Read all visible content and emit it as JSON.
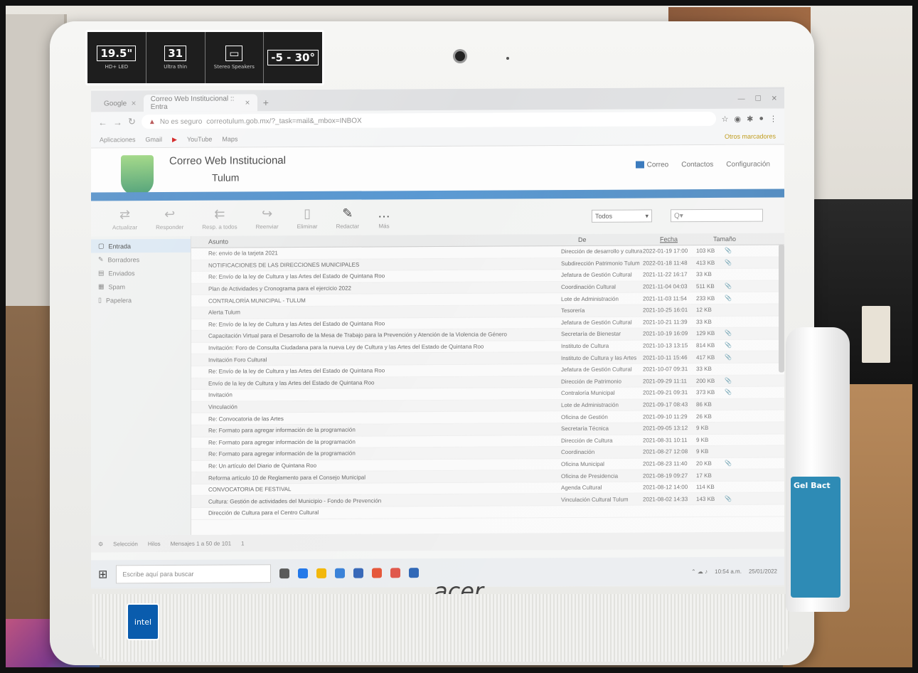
{
  "monitor": {
    "brand": "acer",
    "badge": "intel",
    "specs": [
      {
        "big": "19.5\"",
        "small": "HD+ LED"
      },
      {
        "big": "31",
        "small": "Ultra thin"
      },
      {
        "big": "▭",
        "small": "Stereo Speakers"
      },
      {
        "big": "-5 - 30°",
        "small": ""
      }
    ]
  },
  "bottle": {
    "label": "Gel Bact"
  },
  "browser": {
    "tabs": [
      {
        "label": "Google"
      },
      {
        "label": "Correo Web Institucional :: Entra"
      }
    ],
    "address": {
      "security": "No es seguro",
      "url": "correotulum.gob.mx/?_task=mail&_mbox=INBOX"
    },
    "bookmarks": [
      "Aplicaciones",
      "Gmail",
      "YouTube",
      "Maps"
    ],
    "bookmarks_right": "Otros marcadores"
  },
  "app": {
    "title": "Correo Web Institucional",
    "subtitle": "Tulum",
    "nav": {
      "mail": "Correo",
      "contacts": "Contactos",
      "settings": "Configuración"
    },
    "toolbar": {
      "tools": [
        "Actualizar",
        "Responder",
        "Resp. a todos",
        "Reenviar",
        "Eliminar",
        "Redactar",
        "Más"
      ],
      "filter": "Todos",
      "search_placeholder": "Q▾"
    },
    "folders": [
      "Entrada",
      "Borradores",
      "Enviados",
      "Spam",
      "Papelera"
    ],
    "columns": {
      "subject": "Asunto",
      "from": "De",
      "date": "Fecha",
      "size": "Tamaño"
    },
    "messages": [
      {
        "subject": "Re: envio de la tarjeta 2021",
        "from": "Dirección de desarrollo y cultura",
        "date": "2022-01-19 17:00",
        "size": "103 KB",
        "att": "📎"
      },
      {
        "subject": "NOTIFICACIONES DE LAS DIRECCIONES MUNICIPALES",
        "from": "Subdirección Patrimonio Tulum",
        "date": "2022-01-18 11:48",
        "size": "413 KB",
        "att": "📎"
      },
      {
        "subject": "Re: Envío de la ley de Cultura y las Artes del Estado de Quintana Roo",
        "from": "Jefatura de Gestión Cultural",
        "date": "2021-11-22 16:17",
        "size": "33 KB",
        "att": ""
      },
      {
        "subject": "Plan de Actividades y Cronograma para el ejercicio 2022",
        "from": "Coordinación Cultural",
        "date": "2021-11-04 04:03",
        "size": "511 KB",
        "att": "📎"
      },
      {
        "subject": "CONTRALORÍA MUNICIPAL - TULUM",
        "from": "Lote de Administración",
        "date": "2021-11-03 11:54",
        "size": "233 KB",
        "att": "📎"
      },
      {
        "subject": "Alerta Tulum",
        "from": "Tesorería",
        "date": "2021-10-25 16:01",
        "size": "12 KB",
        "att": ""
      },
      {
        "subject": "Re: Envío de la ley de Cultura y las Artes del Estado de Quintana Roo",
        "from": "Jefatura de Gestión Cultural",
        "date": "2021-10-21 11:39",
        "size": "33 KB",
        "att": ""
      },
      {
        "subject": "Capacitación Virtual para el Desarrollo de la Mesa de Trabajo para la Prevención y Atención de la Violencia de Género",
        "from": "Secretaría de Bienestar",
        "date": "2021-10-19 16:09",
        "size": "129 KB",
        "att": "📎"
      },
      {
        "subject": "Invitación: Foro de Consulta Ciudadana para la nueva Ley de Cultura y las Artes del Estado de Quintana Roo",
        "from": "Instituto de Cultura",
        "date": "2021-10-13 13:15",
        "size": "814 KB",
        "att": "📎"
      },
      {
        "subject": "Invitación Foro Cultural",
        "from": "Instituto de Cultura y las Artes",
        "date": "2021-10-11 15:46",
        "size": "417 KB",
        "att": "📎"
      },
      {
        "subject": "Re: Envío de la ley de Cultura y las Artes del Estado de Quintana Roo",
        "from": "Jefatura de Gestión Cultural",
        "date": "2021-10-07 09:31",
        "size": "33 KB",
        "att": ""
      },
      {
        "subject": "Envío de la ley de Cultura y las Artes del Estado de Quintana Roo",
        "from": "Dirección de Patrimonio",
        "date": "2021-09-29 11:11",
        "size": "200 KB",
        "att": "📎"
      },
      {
        "subject": "Invitación",
        "from": "Contraloría Municipal",
        "date": "2021-09-21 09:31",
        "size": "373 KB",
        "att": "📎"
      },
      {
        "subject": "Vinculación",
        "from": "Lote de Administración",
        "date": "2021-09-17 08:43",
        "size": "86 KB",
        "att": ""
      },
      {
        "subject": "Re: Convocatoria de las Artes",
        "from": "Oficina de Gestión",
        "date": "2021-09-10 11:29",
        "size": "26 KB",
        "att": ""
      },
      {
        "subject": "Re: Formato para agregar información de la programación",
        "from": "Secretaría Técnica",
        "date": "2021-09-05 13:12",
        "size": "9 KB",
        "att": ""
      },
      {
        "subject": "Re: Formato para agregar información de la programación",
        "from": "Dirección de Cultura",
        "date": "2021-08-31 10:11",
        "size": "9 KB",
        "att": ""
      },
      {
        "subject": "Re: Formato para agregar información de la programación",
        "from": "Coordinación",
        "date": "2021-08-27 12:08",
        "size": "9 KB",
        "att": ""
      },
      {
        "subject": "Re: Un artículo del Diario de Quintana Roo",
        "from": "Oficina Municipal",
        "date": "2021-08-23 11:40",
        "size": "20 KB",
        "att": "📎"
      },
      {
        "subject": "Reforma artículo 10 de Reglamento para el Consejo Municipal",
        "from": "Oficina de Presidencia",
        "date": "2021-08-19 09:27",
        "size": "17 KB",
        "att": ""
      },
      {
        "subject": "CONVOCATORIA DE FESTIVAL",
        "from": "Agenda Cultural",
        "date": "2021-08-12 14:00",
        "size": "114 KB",
        "att": ""
      },
      {
        "subject": "Cultura: Gestión de actividades del Municipio - Fondo de Prevención",
        "from": "Vinculación Cultural Tulum",
        "date": "2021-08-02 14:33",
        "size": "143 KB",
        "att": "📎"
      },
      {
        "subject": "Dirección de Cultura para el Centro Cultural",
        "from": "",
        "date": "",
        "size": "",
        "att": ""
      }
    ],
    "footer": {
      "selection": "Selección",
      "threads": "Hilos",
      "count": "Mensajes 1 a 50 de 101",
      "pages": "1"
    }
  },
  "taskbar": {
    "search": "Escribe aquí para buscar",
    "time": "10:54 a.m.",
    "date": "25/01/2022"
  }
}
